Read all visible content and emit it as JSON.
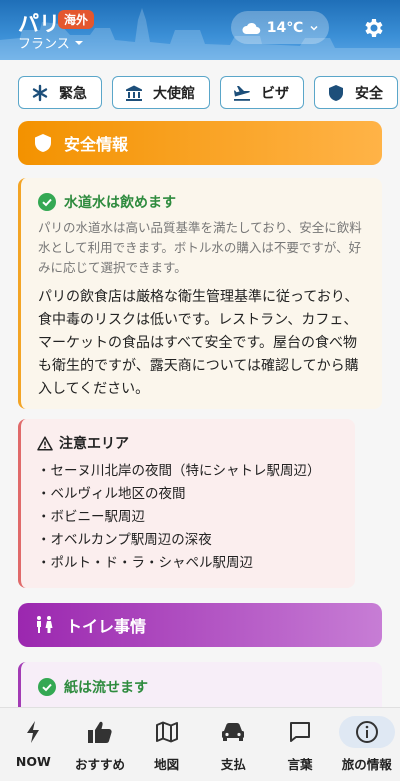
{
  "header": {
    "city": "パリ",
    "badge": "海外",
    "country": "フランス",
    "weather": "14℃"
  },
  "chips": [
    {
      "icon": "asterisk-icon",
      "label": "緊急"
    },
    {
      "icon": "bank-icon",
      "label": "大使館"
    },
    {
      "icon": "airplane-icon",
      "label": "ビザ"
    },
    {
      "icon": "shield-icon",
      "label": "安全"
    }
  ],
  "safety": {
    "title": "安全情報",
    "water_title": "水道水は飲めます",
    "water_sub": "パリの水道水は高い品質基準を満たしており、安全に飲料水として利用できます。ボトル水の購入は不要ですが、好みに応じて選択できます。",
    "water_main": "パリの飲食店は厳格な衛生管理基準に従っており、食中毒のリスクは低いです。レストラン、カフェ、マーケットの食品はすべて安全です。屋台の食べ物も衛生的ですが、露天商については確認してから購入してください。"
  },
  "caution": {
    "title": "注意エリア",
    "items": [
      "・セーヌ川北岸の夜間（特にシャトレ駅周辺）",
      "・ベルヴィル地区の夜間",
      "・ボビニー駅周辺",
      "・オベルカンプ駅周辺の深夜",
      "・ポルト・ド・ラ・シャペル駅周辺"
    ]
  },
  "toilet": {
    "title": "トイレ事情",
    "ok_title": "紙は流せます"
  },
  "nav": [
    {
      "icon": "bolt-icon",
      "label": "NOW"
    },
    {
      "icon": "thumbs-up-icon",
      "label": "おすすめ"
    },
    {
      "icon": "map-icon",
      "label": "地図"
    },
    {
      "icon": "car-icon",
      "label": "支払"
    },
    {
      "icon": "chat-icon",
      "label": "言葉"
    },
    {
      "icon": "info-icon",
      "label": "旅の情報"
    }
  ],
  "colors": {
    "header": "#3b8fd6",
    "safety_bar": "#f39200",
    "toilet_bar": "#9b27af",
    "ok_green": "#34a853",
    "caution_red": "#e06a6a"
  }
}
